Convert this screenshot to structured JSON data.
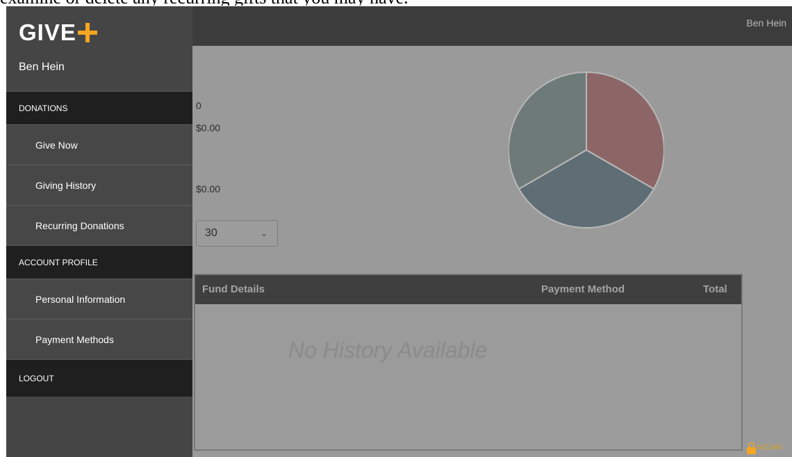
{
  "caption": "examine or delete any recurring gifts that you may have.",
  "topbar": {
    "user_name": "Ben Hein"
  },
  "sidebar": {
    "brand": "GIVE",
    "user_name": "Ben Hein",
    "sections": [
      {
        "label": "DONATIONS"
      },
      {
        "label": "ACCOUNT PROFILE"
      }
    ],
    "items": [
      {
        "label": "Give Now"
      },
      {
        "label": "Giving History"
      },
      {
        "label": "Recurring Donations"
      },
      {
        "label": "Personal Information"
      },
      {
        "label": "Payment Methods"
      }
    ],
    "logout_label": "LOGOUT"
  },
  "stats": {
    "count": "0",
    "amount_primary": "$0.00",
    "amount_secondary": "$0.00"
  },
  "period_select": {
    "value": "30"
  },
  "pie_chart": {
    "colors": [
      "#8c6666",
      "#5f6d74",
      "#6e7a78"
    ]
  },
  "history_table": {
    "columns": [
      "Fund Details",
      "Payment Method",
      "Total"
    ],
    "empty_message": "No History Available"
  },
  "badge": {
    "text": "SECURE",
    "color": "#f5a623"
  },
  "colors": {
    "accent": "#f5a623",
    "topbar": "#3c3c3c",
    "nav_section": "#1f1f1f"
  }
}
